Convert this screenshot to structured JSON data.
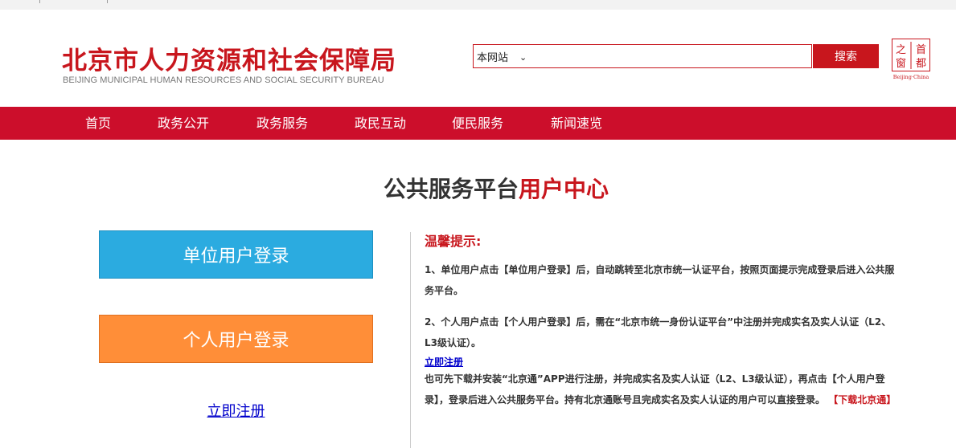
{
  "header": {
    "title_cn": "北京市人力资源和社会保障局",
    "title_en": "BEIJING MUNICIPAL HUMAN RESOURCES AND SOCIAL SECURITY BUREAU",
    "search": {
      "scope_selected": "本网站",
      "placeholder": "",
      "button_label": "搜索"
    },
    "seal": {
      "chars": [
        "首",
        "之",
        "都",
        "窗"
      ],
      "caption": "Beijing·China"
    }
  },
  "nav": {
    "items": [
      {
        "label": "首页"
      },
      {
        "label": "政务公开"
      },
      {
        "label": "政务服务"
      },
      {
        "label": "政民互动"
      },
      {
        "label": "便民服务"
      },
      {
        "label": "新闻速览"
      }
    ]
  },
  "main": {
    "title_prefix": "公共服务平台",
    "title_accent": "用户中心",
    "unit_login_label": "单位用户登录",
    "personal_login_label": "个人用户登录",
    "register_label": "立即注册"
  },
  "tips": {
    "title": "温馨提示:",
    "tip1": "1、单位用户点击【单位用户登录】后，自动跳转至北京市统一认证平台，按照页面提示完成登录后进入公共服务平台。",
    "tip2": "2、个人用户点击【个人用户登录】后，需在“北京市统一身份认证平台”中注册并完成实名及实人认证（L2、L3级认证）。",
    "register_link": "立即注册",
    "tip3_text": "也可先下载并安装“北京通”APP进行注册，并完成实名及实人认证（L2、L3级认证），再点击【个人用户登录】，登录后进入公共服务平台。持有北京通账号且完成实名及实人认证的用户可以直接登录。",
    "download_link": "【下载北京通】"
  },
  "colors": {
    "brand_red": "#c8161d",
    "nav_red": "#cc0e2b",
    "unit_blue": "#2babe0",
    "personal_orange": "#ff8e38",
    "link_blue": "#0000cc"
  }
}
